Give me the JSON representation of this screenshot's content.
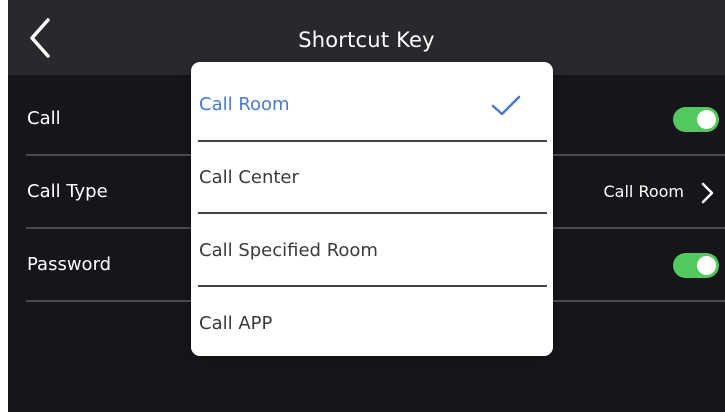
{
  "header": {
    "title": "Shortcut Key",
    "back_icon": "chevron-left-icon"
  },
  "settings": {
    "call": {
      "label": "Call",
      "enabled": true
    },
    "call_type": {
      "label": "Call Type",
      "value": "Call Room",
      "icon": "chevron-right-icon"
    },
    "password": {
      "label": "Password",
      "enabled": true
    }
  },
  "dropdown": {
    "selected": "Call Room",
    "options": [
      {
        "label": "Call Room",
        "selected": true
      },
      {
        "label": "Call Center",
        "selected": false
      },
      {
        "label": "Call Specified Room",
        "selected": false
      },
      {
        "label": "Call APP",
        "selected": false
      }
    ],
    "check_icon": "checkmark-icon"
  },
  "colors": {
    "background": "#151619",
    "header": "#29292d",
    "accent": "#52c85f",
    "selected_text": "#4a78d1",
    "divider": "#4a4b50",
    "dropdown_background": "#ffffff"
  }
}
